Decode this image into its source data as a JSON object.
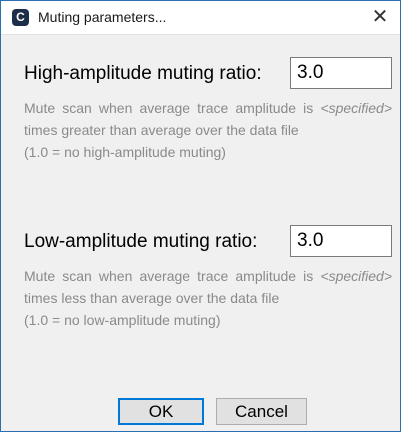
{
  "window": {
    "title": "Muting parameters...",
    "app_icon_glyph": "C",
    "close_glyph": "✕"
  },
  "high": {
    "label": "High-amplitude muting ratio:",
    "value": "3.0",
    "desc_pre": "Mute scan when average trace amplitude is ",
    "desc_em": "<specified>",
    "desc_post": " times greater than average over the data file",
    "note": "(1.0 = no high-amplitude muting)"
  },
  "low": {
    "label": "Low-amplitude muting ratio:",
    "value": "3.0",
    "desc_pre": "Mute scan when average trace amplitude is ",
    "desc_em": "<specified>",
    "desc_post": " times less than average over the data file",
    "note": "(1.0 = no low-amplitude muting)"
  },
  "buttons": {
    "ok": "OK",
    "cancel": "Cancel"
  },
  "colors": {
    "accent": "#0078d7",
    "window_border": "#2b6fb3",
    "description_text": "#8a8a8a"
  }
}
